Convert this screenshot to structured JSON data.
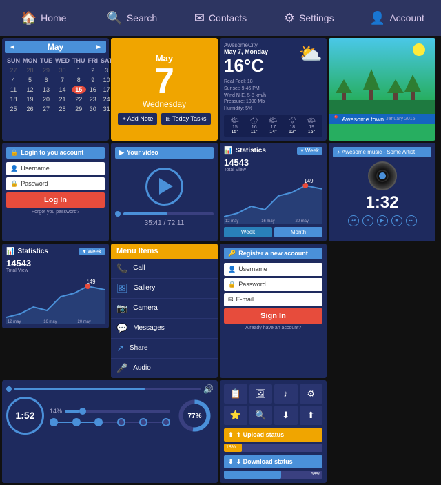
{
  "nav": {
    "items": [
      {
        "label": "Home",
        "icon": "🏠"
      },
      {
        "label": "Search",
        "icon": "🔍"
      },
      {
        "label": "Contacts",
        "icon": "✉"
      },
      {
        "label": "Settings",
        "icon": "⚙"
      },
      {
        "label": "Account",
        "icon": "👤"
      }
    ]
  },
  "calendar": {
    "month": "May",
    "prev_arrow": "◄",
    "next_arrow": "►",
    "days": [
      "SUN",
      "MON",
      "TUE",
      "WED",
      "THU",
      "FRI",
      "SAT"
    ],
    "weeks": [
      [
        "27",
        "28",
        "29",
        "30",
        "1",
        "2",
        "3"
      ],
      [
        "4",
        "5",
        "6",
        "7",
        "8",
        "9",
        "10"
      ],
      [
        "11",
        "12",
        "13",
        "14",
        "15",
        "16",
        "17"
      ],
      [
        "18",
        "19",
        "20",
        "21",
        "22",
        "23",
        "24"
      ],
      [
        "25",
        "26",
        "27",
        "28",
        "29",
        "30",
        "31"
      ]
    ],
    "today": "15"
  },
  "big_date": {
    "month": "May",
    "day_number": "7",
    "day_name": "Wednesday",
    "add_note": "+ Add Note",
    "today_tasks": "⊞ Today Tasks"
  },
  "weather": {
    "city": "AwesomeCity",
    "date": "May 7, Monday",
    "temp": "16°C",
    "icon": "⛅",
    "feel": "Real Feel: 18",
    "wind": "Wind N-E, 5-8 km/h",
    "sunset": "Sunset: 9:46 PM",
    "pressure": "Pressure: 1000 Mb",
    "humidity": "Humidity: 5%",
    "forecast": [
      {
        "day": "15",
        "icon": "🌤",
        "temp": "15°"
      },
      {
        "day": "16",
        "icon": "🌧",
        "temp": "11°"
      },
      {
        "day": "17",
        "icon": "🌤",
        "temp": "14°"
      },
      {
        "day": "18",
        "icon": "🌩",
        "temp": "12°"
      },
      {
        "day": "19",
        "icon": "🌤",
        "temp": "16°"
      }
    ]
  },
  "scenic": {
    "location": "Awesome town",
    "date": "January 2015"
  },
  "login": {
    "header": "🔒 Login to you account",
    "username_placeholder": "Username",
    "password_placeholder": "Password",
    "login_label": "Log In",
    "forgot_label": "Forgot you password?"
  },
  "video": {
    "header": "▶ Your video",
    "time_current": "35:41",
    "time_total": "72:11",
    "progress_pct": 49
  },
  "stats_big": {
    "header": "📊 Statistics",
    "total_views": "14543",
    "total_label": "Total View",
    "peak_label": "149",
    "week_btn": "▾ Week",
    "week_label": "Week",
    "month_label": "Month",
    "date_start": "12 may",
    "date_mid": "16 may",
    "date_end": "20 may"
  },
  "stats_small": {
    "header": "📊 Statistics",
    "week_btn": "▾ Week",
    "total_views": "14543",
    "total_label": "Total View",
    "peak_label": "149"
  },
  "music": {
    "header": "♪ Awesome music - Some Artist",
    "time": "1:32",
    "controls": [
      "⏮",
      "⏸",
      "▶",
      "⏹",
      "⏭"
    ]
  },
  "audio": {
    "time": "1:52",
    "volume_pct": 70,
    "percentage": "77%",
    "slider_pct": "14%",
    "slider_val": 14,
    "steps": [
      1,
      2,
      3,
      4,
      5,
      6
    ]
  },
  "menu": {
    "header": "Menu Items",
    "items": [
      {
        "icon": "📞",
        "label": "Call"
      },
      {
        "icon": "🖼",
        "label": "Gallery"
      },
      {
        "icon": "📷",
        "label": "Camera"
      },
      {
        "icon": "💬",
        "label": "Messages"
      },
      {
        "icon": "↗",
        "label": "Share"
      },
      {
        "icon": "🎤",
        "label": "Audio"
      }
    ]
  },
  "register": {
    "header": "🔑 Register a new account",
    "username_placeholder": "Username",
    "password_placeholder": "Password",
    "email_placeholder": "E-mail",
    "signin_label": "Sign In",
    "already_label": "Already have an account?"
  },
  "status": {
    "icons": [
      "📋",
      "🖼",
      "♪",
      "⚙",
      "⭐",
      "🔍",
      "⬇",
      "⬆"
    ],
    "upload_label": "⬆ Upload status",
    "upload_pct": "18%",
    "upload_fill": 18,
    "download_label": "⬇ Download status",
    "download_pct": "58%",
    "download_fill": 58
  }
}
